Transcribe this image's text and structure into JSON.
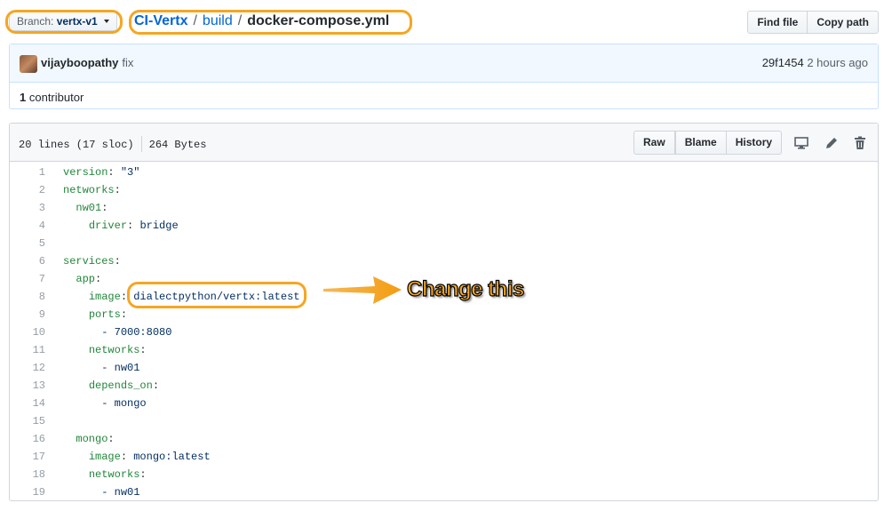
{
  "branch": {
    "label": "Branch:",
    "value": "vertx-v1"
  },
  "breadcrumb": {
    "repo": "CI-Vertx",
    "sep1": "/",
    "folder": "build",
    "sep2": "/",
    "file": "docker-compose.yml"
  },
  "toolbar": {
    "find_file": "Find file",
    "copy_path": "Copy path"
  },
  "commit": {
    "author": "vijayboopathy",
    "message": "fix",
    "sha": "29f1454",
    "time": "2 hours ago"
  },
  "contributors": {
    "count": "1",
    "label": "contributor"
  },
  "file": {
    "lines_info": "20 lines (17 sloc)",
    "size": "264 Bytes",
    "buttons": {
      "raw": "Raw",
      "blame": "Blame",
      "history": "History"
    },
    "icons": [
      "desktop-icon",
      "pencil-icon",
      "trash-icon"
    ]
  },
  "code": [
    {
      "n": "1",
      "indent": "",
      "key": "version",
      "sep": ": ",
      "val": "\"3\""
    },
    {
      "n": "2",
      "indent": "",
      "key": "networks",
      "sep": ":",
      "val": ""
    },
    {
      "n": "3",
      "indent": "  ",
      "key": "nw01",
      "sep": ":",
      "val": ""
    },
    {
      "n": "4",
      "indent": "    ",
      "key": "driver",
      "sep": ": ",
      "val": "bridge"
    },
    {
      "n": "5",
      "indent": "",
      "key": "",
      "sep": "",
      "val": ""
    },
    {
      "n": "6",
      "indent": "",
      "key": "services",
      "sep": ":",
      "val": ""
    },
    {
      "n": "7",
      "indent": "  ",
      "key": "app",
      "sep": ":",
      "val": ""
    },
    {
      "n": "8",
      "indent": "    ",
      "key": "image",
      "sep": ": ",
      "val": "dialectpython/vertx:latest"
    },
    {
      "n": "9",
      "indent": "    ",
      "key": "ports",
      "sep": ":",
      "val": ""
    },
    {
      "n": "10",
      "indent": "      ",
      "key": "",
      "sep": "",
      "val": "- 7000:8080"
    },
    {
      "n": "11",
      "indent": "    ",
      "key": "networks",
      "sep": ":",
      "val": ""
    },
    {
      "n": "12",
      "indent": "      ",
      "key": "",
      "sep": "",
      "val": "- nw01"
    },
    {
      "n": "13",
      "indent": "    ",
      "key": "depends_on",
      "sep": ":",
      "val": ""
    },
    {
      "n": "14",
      "indent": "      ",
      "key": "",
      "sep": "",
      "val": "- mongo"
    },
    {
      "n": "15",
      "indent": "",
      "key": "",
      "sep": "",
      "val": ""
    },
    {
      "n": "16",
      "indent": "  ",
      "key": "mongo",
      "sep": ":",
      "val": ""
    },
    {
      "n": "17",
      "indent": "    ",
      "key": "image",
      "sep": ": ",
      "val": "mongo:latest"
    },
    {
      "n": "18",
      "indent": "    ",
      "key": "networks",
      "sep": ":",
      "val": ""
    },
    {
      "n": "19",
      "indent": "      ",
      "key": "",
      "sep": "",
      "val": "- nw01"
    }
  ],
  "annotation": {
    "text": "Change this",
    "color": "#f5a623"
  }
}
